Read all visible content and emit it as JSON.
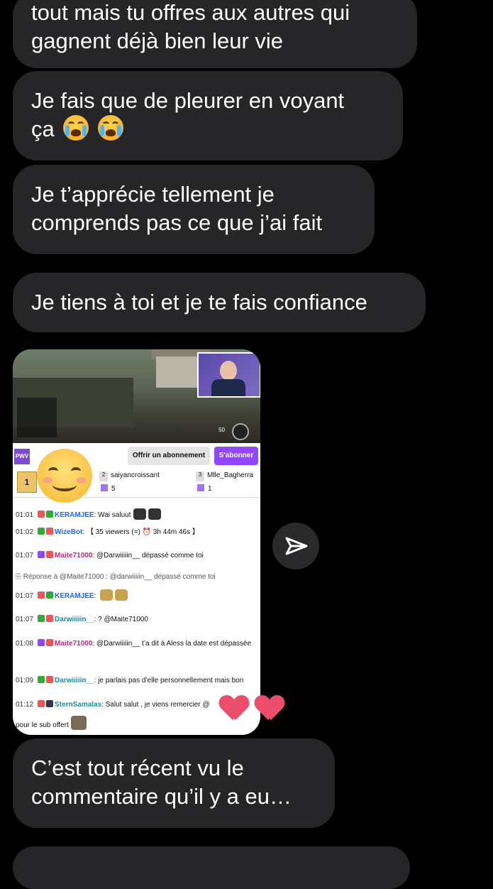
{
  "messages": [
    {
      "text": "tout mais tu offres aux autres qui\ngagnent déjà bien leur vie"
    },
    {
      "text": "Je fais que de pleurer en voyant\nça",
      "emojis": [
        "loudly-crying-face",
        "loudly-crying-face"
      ]
    },
    {
      "text": "Je t’apprécie tellement je\ncomprends pas ce que j’ai fait"
    },
    {
      "text": "Je tiens à toi et je te fais confiance"
    },
    {
      "text": "C’est tout récent vu le\ncommentaire qu’il y a eu…"
    }
  ],
  "shared_image": {
    "stream": {
      "logo": "PWV",
      "gift_button": "Offrir un abonnement",
      "subscribe_button": "S'abonner",
      "top_gifters": [
        {
          "rank": "1",
          "name": "",
          "count": ""
        },
        {
          "rank": "2",
          "name": "saiyancroissant",
          "count": "5"
        },
        {
          "rank": "3",
          "name": "Mlle_Bagherra",
          "count": "1"
        }
      ],
      "video_overlay_number": "50"
    },
    "chat": [
      {
        "time": "01:01",
        "user": "KERAMJEE",
        "user_color": "#1f69ff",
        "message": "Wai saluut"
      },
      {
        "time": "01:02",
        "user": "WizeBot",
        "user_color": "#1f69ff",
        "message": "【 35 viewers (=) ⏰ 3h 44m 46s 】"
      },
      {
        "time": "01:07",
        "user": "Maite71000",
        "user_color": "#b0307a",
        "message": "@Darwiiiiin__ dépassé comme toi"
      },
      {
        "reply": "Réponse à @Maite71000 : @darwiiiiin__ dépassé comme toi"
      },
      {
        "time": "01:07",
        "user": "KERAMJEE",
        "user_color": "#1f69ff",
        "message": ""
      },
      {
        "time": "01:07",
        "user": "Darwiiiiin__",
        "user_color": "#1f8a9a",
        "message": "? @Maite71000"
      },
      {
        "time": "01:08",
        "user": "Maite71000",
        "user_color": "#b0307a",
        "message": "@Darwiiiiin__ t’a dit à Aless la date est dépassée"
      },
      {
        "time": "01:09",
        "user": "Darwiiiiin__",
        "user_color": "#1f8a9a",
        "message": "je parlais pas d’elle personnellement mais bon"
      },
      {
        "time": "01:12",
        "user": "SternSamalas",
        "user_color": "#1f8a9a",
        "message": "Salut salut , je viens remercier @"
      },
      {
        "message": "pour le sub offert"
      }
    ]
  },
  "icons": {
    "share": "paper-plane-icon",
    "smiley": "smiling-face-icon",
    "hearts": "red-heart-icon"
  },
  "colors": {
    "bubble": "#262628",
    "background": "#000000",
    "twitch_purple": "#9147ff"
  }
}
